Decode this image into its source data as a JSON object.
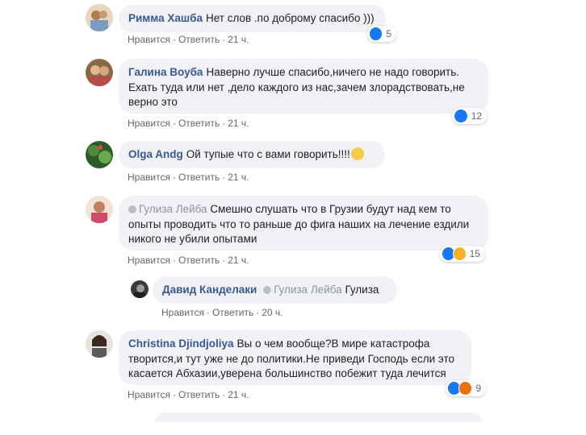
{
  "actions": {
    "like": "Нравится",
    "reply": "Ответить",
    "sep": "·"
  },
  "colors": {
    "author": "#385898",
    "bubble": "#f0f2f5",
    "like": "#1877f2"
  },
  "comments": [
    {
      "author": "Римма Хашба",
      "text": "Нет слов .по доброму спасибо )))",
      "time": "21 ч.",
      "reactions": {
        "icons": [
          "like-icon"
        ],
        "count": "5"
      }
    },
    {
      "author": "Галина Воуба",
      "text": "Наверно лучше спасибо,ничего не надо говорить. Ехать туда или нет ,дело каждого из нас,зачем злорадствовать,не верно это",
      "time": "21 ч.",
      "reactions": {
        "icons": [
          "like-icon"
        ],
        "count": "12"
      }
    },
    {
      "author": "Olga Andg",
      "text": "Ой тупые что с вами говорить!!!!",
      "emoji": "thinking-face-emoji",
      "time": "21 ч."
    },
    {
      "mention": "Гулиза Лейба",
      "text": "Смешно слушать что в Грузии будут над кем то опыты проводить что то раньше до фига наших на лечение ездили никого не убили опытами",
      "time": "21 ч.",
      "reactions": {
        "icons": [
          "like-icon",
          "haha-icon"
        ],
        "count": "15"
      }
    },
    {
      "author": "Давид Канделаки",
      "mention": "Гулиза Лейба",
      "text": "Гулиза",
      "time": "20 ч."
    },
    {
      "author": "Christina Djindjoliya",
      "text": "Вы о чем вообще?В мире катастрофа творится,и тут уже не до политики.Не приведи Господь если это касается Абхазии,уверена большинство побежит туда лечится",
      "time": "21 ч.",
      "reactions": {
        "icons": [
          "like-icon",
          "angry-icon"
        ],
        "count": "9"
      }
    }
  ]
}
